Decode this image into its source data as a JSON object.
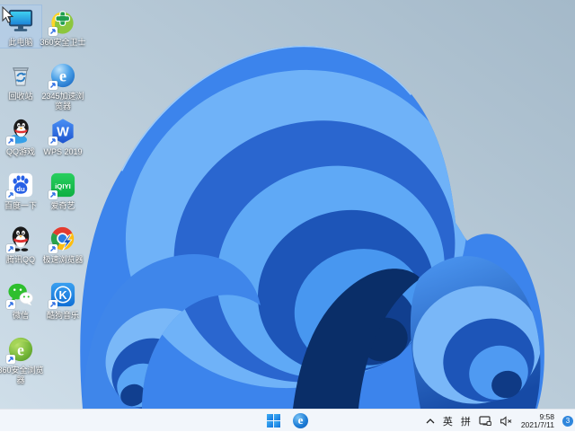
{
  "desktop": {
    "icons": [
      {
        "name": "this-pc",
        "label": "此电脑",
        "col": 0,
        "row": 0,
        "selected": true,
        "shortcut": false
      },
      {
        "name": "safety-360",
        "label": "360安全卫士",
        "col": 1,
        "row": 0,
        "selected": false,
        "shortcut": true
      },
      {
        "name": "recycle-bin",
        "label": "回收站",
        "col": 0,
        "row": 1,
        "selected": false,
        "shortcut": false
      },
      {
        "name": "browser-2345",
        "label": "2345加速浏览器",
        "col": 1,
        "row": 1,
        "selected": false,
        "shortcut": true
      },
      {
        "name": "qq-games",
        "label": "QQ游戏",
        "col": 0,
        "row": 2,
        "selected": false,
        "shortcut": true
      },
      {
        "name": "wps-2019",
        "label": "WPS 2019",
        "col": 1,
        "row": 2,
        "selected": false,
        "shortcut": true
      },
      {
        "name": "baidu",
        "label": "百度一下",
        "col": 0,
        "row": 3,
        "selected": false,
        "shortcut": true
      },
      {
        "name": "iqiyi",
        "label": "爱奇艺",
        "col": 1,
        "row": 3,
        "selected": false,
        "shortcut": true
      },
      {
        "name": "tencent-qq",
        "label": "腾讯QQ",
        "col": 0,
        "row": 4,
        "selected": false,
        "shortcut": true
      },
      {
        "name": "speed-browser",
        "label": "极速浏览器",
        "col": 1,
        "row": 4,
        "selected": false,
        "shortcut": true
      },
      {
        "name": "wechat",
        "label": "微信",
        "col": 0,
        "row": 5,
        "selected": false,
        "shortcut": true
      },
      {
        "name": "kugou-music",
        "label": "酷狗音乐",
        "col": 1,
        "row": 5,
        "selected": false,
        "shortcut": true
      },
      {
        "name": "browser-360",
        "label": "360安全浏览器",
        "col": 0,
        "row": 6,
        "selected": false,
        "shortcut": true
      }
    ]
  },
  "taskbar": {
    "ime_en": "英",
    "ime_pinyin": "拼",
    "time": "9:58",
    "date": "2021/7/11",
    "badge_count": "3"
  }
}
